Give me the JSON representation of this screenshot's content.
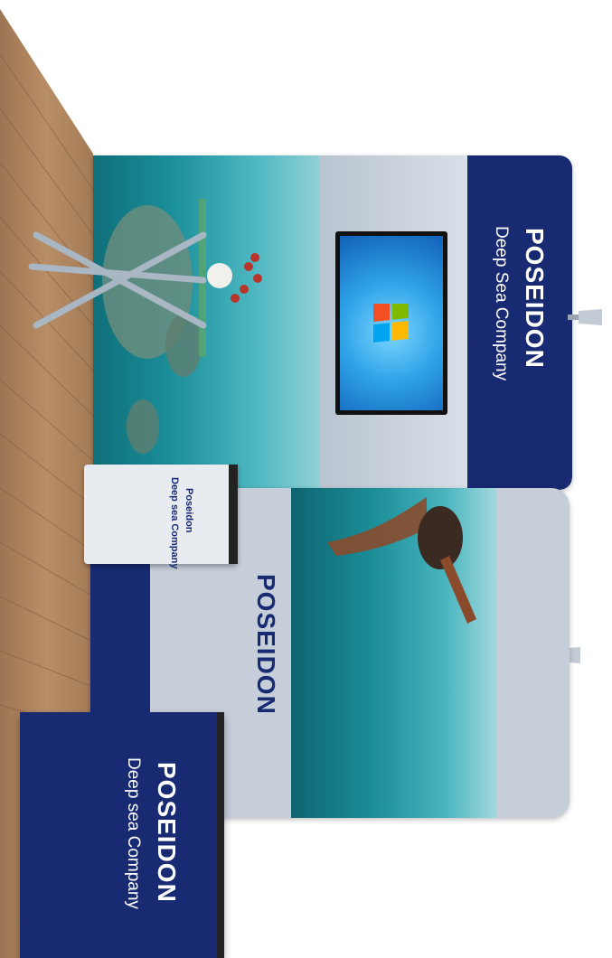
{
  "scene": {
    "description_colors": {
      "navy": "#182a72",
      "sea": "#1b8f9a",
      "wall_grey": "#c9d3de",
      "floor_wood": "#b58a63"
    }
  },
  "banner_top": {
    "brand": "POSEIDON",
    "subtitle": "Deep Sea Company"
  },
  "counter": {
    "brand": "Poseidon",
    "subtitle": "Deep sea Company"
  },
  "wall_bottom": {
    "brand": "POSEIDON"
  },
  "podium": {
    "brand": "POSEIDON",
    "subtitle": "Deep sea Company"
  },
  "tv": {
    "logo_icon": "windows-logo-icon"
  }
}
